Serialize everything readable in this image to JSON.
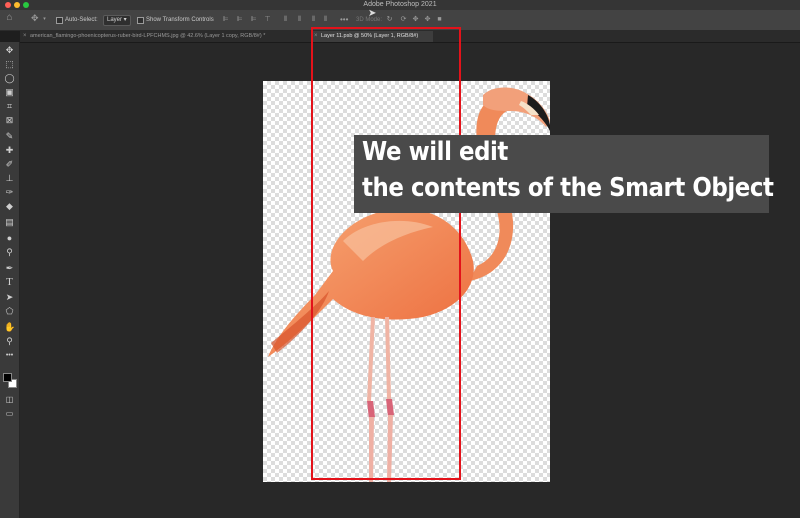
{
  "window": {
    "title": "Adobe Photoshop 2021",
    "traffic_light_colors": [
      "#ff5f57",
      "#febc2e",
      "#28c840"
    ]
  },
  "options_bar": {
    "move_tool_icon": "move-icon",
    "auto_select_label": "Auto-Select:",
    "auto_select_value": "Layer",
    "show_transform_label": "Show Transform Controls",
    "mode_3d_label": "3D Mode:"
  },
  "tabs": [
    {
      "label": "american_flamingo-phoenicopterus-ruber-bird-LPFCHMS.jpg @ 42.6% (Layer 1 copy, RGB/8#) *",
      "active": false
    },
    {
      "label": "Layer 11.psb @ 50% (Layer 1, RGB/8#)",
      "active": true
    }
  ],
  "tools": [
    "move-icon",
    "marquee-icon",
    "lasso-icon",
    "object-select-icon",
    "crop-icon",
    "frame-icon",
    "eyedropper-icon",
    "healing-icon",
    "brush-icon",
    "stamp-icon",
    "history-brush-icon",
    "eraser-icon",
    "gradient-icon",
    "blur-icon",
    "dodge-icon",
    "pen-icon",
    "type-icon",
    "path-select-icon",
    "shape-icon",
    "hand-icon",
    "zoom-icon",
    "more-icon"
  ],
  "colors": {
    "foreground": "#000000",
    "background": "#ffffff",
    "highlight": "#e3121a",
    "caption_bg": "#4a4a4a"
  },
  "caption": {
    "line1": "We will edit",
    "line2": "the contents of the Smart Object"
  }
}
